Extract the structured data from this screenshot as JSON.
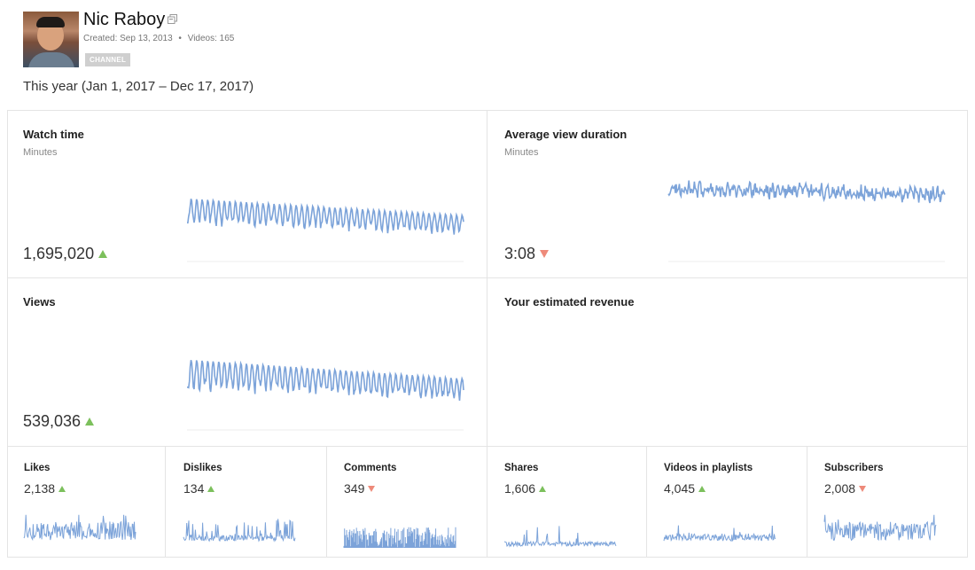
{
  "channel": {
    "name": "Nic Raboy",
    "created": "Created: Sep 13, 2013",
    "separator": "•",
    "videos": "Videos: 165",
    "badge": "CHANNEL",
    "external_link_icon": "external-link-icon",
    "avatar_icon": "profile-photo"
  },
  "date_range": "This year (Jan 1, 2017 – Dec 17, 2017)",
  "colors": {
    "line": "#7ca3d9",
    "up": "#7cc05c",
    "down": "#ee8a7a",
    "divider": "#e4e4e4"
  },
  "cards": {
    "watch_time": {
      "title": "Watch time",
      "subtitle": "Minutes",
      "value": "1,695,020",
      "trend": "up"
    },
    "avg_view_duration": {
      "title": "Average view duration",
      "subtitle": "Minutes",
      "value": "3:08",
      "trend": "down"
    },
    "views": {
      "title": "Views",
      "value": "539,036",
      "trend": "up"
    },
    "revenue": {
      "title": "Your estimated revenue"
    }
  },
  "stats": [
    {
      "title": "Likes",
      "value": "2,138",
      "trend": "up"
    },
    {
      "title": "Dislikes",
      "value": "134",
      "trend": "up"
    },
    {
      "title": "Comments",
      "value": "349",
      "trend": "down"
    },
    {
      "title": "Shares",
      "value": "1,606",
      "trend": "up"
    },
    {
      "title": "Videos in playlists",
      "value": "4,045",
      "trend": "up"
    },
    {
      "title": "Subscribers",
      "value": "2,008",
      "trend": "down"
    }
  ]
}
